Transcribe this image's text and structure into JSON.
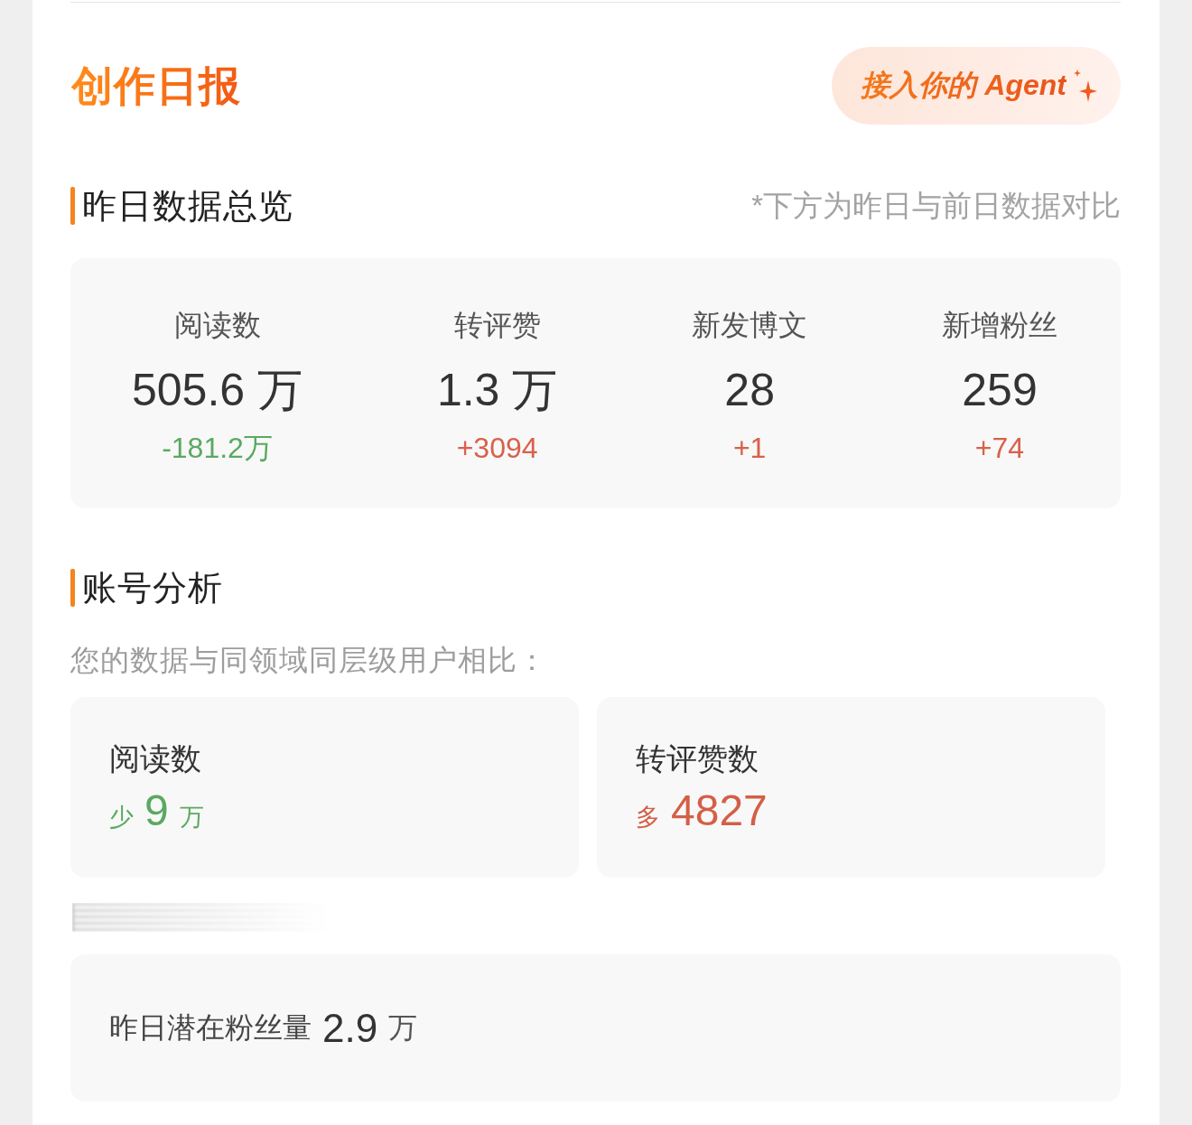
{
  "header": {
    "title": "创作日报",
    "agent_button": {
      "label": "接入你的 Agent"
    }
  },
  "overview": {
    "title": "昨日数据总览",
    "note": "*下方为昨日与前日数据对比",
    "stats": [
      {
        "label": "阅读数",
        "value": "505.6 万",
        "change": "-181.2万",
        "color": "#5aa960"
      },
      {
        "label": "转评赞",
        "value": "1.3 万",
        "change": "+3094",
        "color": "#d9604a"
      },
      {
        "label": "新发博文",
        "value": "28",
        "change": "+1",
        "color": "#d9604a"
      },
      {
        "label": "新增粉丝",
        "value": "259",
        "change": "+74",
        "color": "#d9604a"
      }
    ]
  },
  "analysis": {
    "title": "账号分析",
    "subtitle": "您的数据与同领域同层级用户相比：",
    "comparisons": [
      {
        "label": "阅读数",
        "direction": "少",
        "value": "9",
        "unit": "万",
        "color": "#5aa960"
      },
      {
        "label": "转评赞数",
        "direction": "多",
        "value": "4827",
        "color": "#d45f47"
      }
    ]
  },
  "potential_fans": {
    "label": "昨日潜在粉丝量",
    "value": "2.9",
    "unit": "万"
  }
}
